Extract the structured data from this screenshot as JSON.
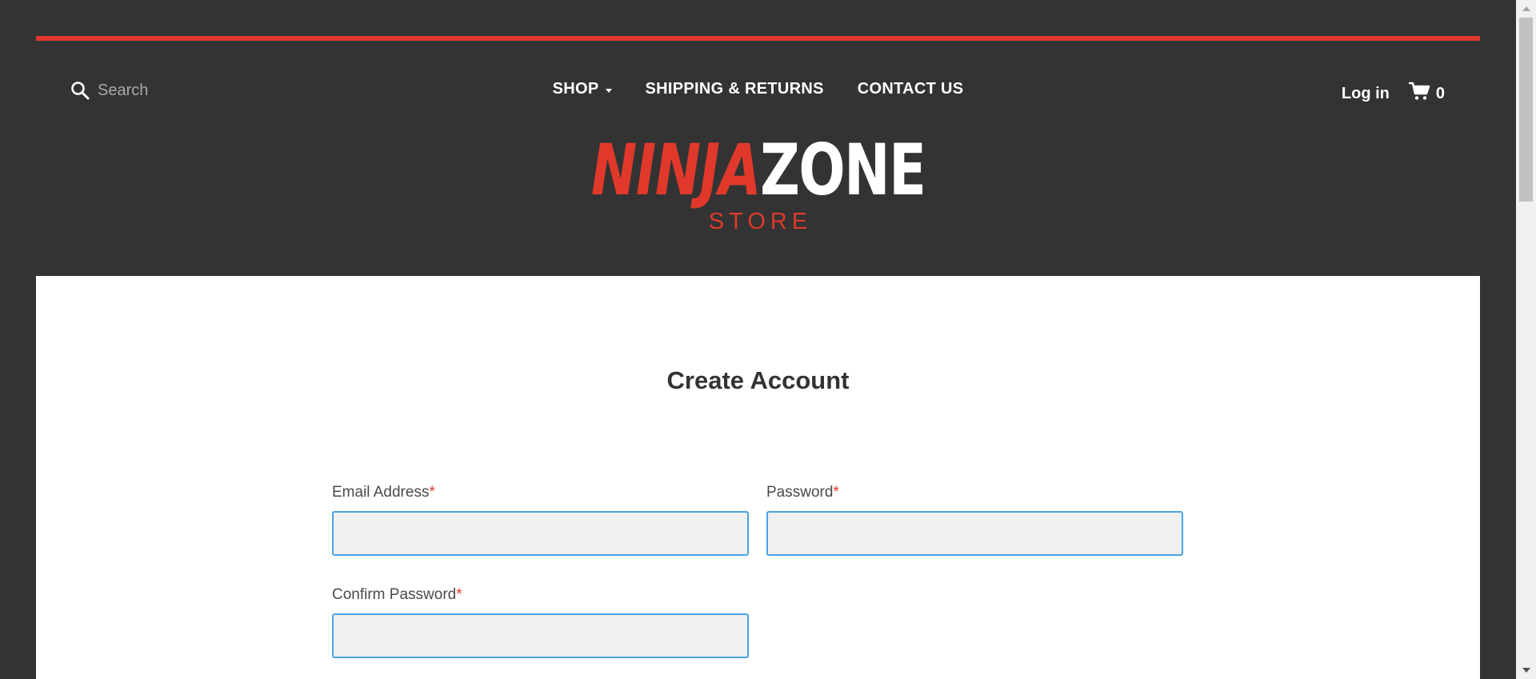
{
  "header": {
    "search": {
      "placeholder": "Search",
      "icon": "search-icon"
    },
    "nav": [
      {
        "label": "SHOP",
        "has_dropdown": true
      },
      {
        "label": "SHIPPING & RETURNS"
      },
      {
        "label": "CONTACT US"
      }
    ],
    "login_label": "Log in",
    "cart": {
      "icon": "cart-icon",
      "count": "0"
    },
    "logo": {
      "part1": "NINJA",
      "part2": "ZONE",
      "sub": "STORE"
    }
  },
  "form": {
    "title": "Create Account",
    "fields": {
      "email": {
        "label": "Email Address",
        "required_mark": "*",
        "value": ""
      },
      "password": {
        "label": "Password",
        "required_mark": "*",
        "value": ""
      },
      "confirm": {
        "label": "Confirm Password",
        "required_mark": "*",
        "value": ""
      }
    }
  },
  "colors": {
    "accent": "#e0392b",
    "header_bg": "#333333",
    "input_border": "#4aa3df",
    "input_bg": "#f0f0f0"
  }
}
